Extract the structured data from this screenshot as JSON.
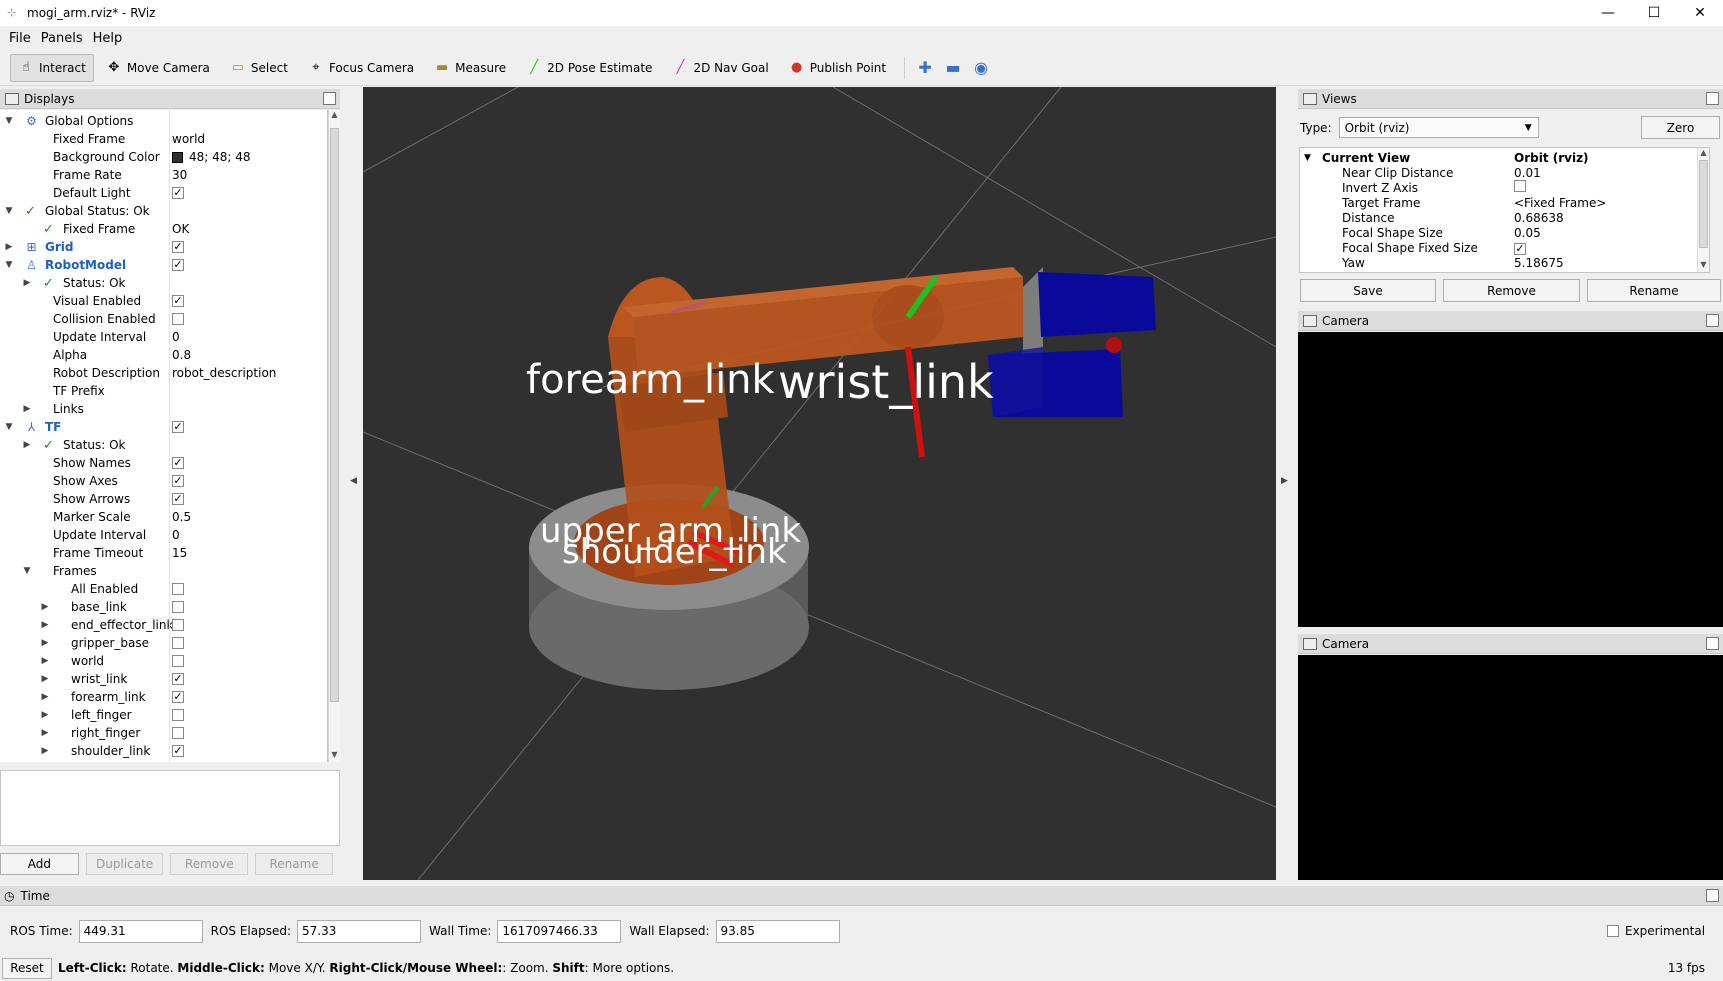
{
  "window": {
    "title": "mogi_arm.rviz* - RViz",
    "minimize": "—",
    "maximize": "☐",
    "close": "✕"
  },
  "menu": [
    "File",
    "Panels",
    "Help"
  ],
  "toolbar": {
    "tools": [
      {
        "label": "Interact",
        "icon": "hand-icon",
        "glyph": "☝",
        "active": true
      },
      {
        "label": "Move Camera",
        "icon": "move-camera-icon",
        "glyph": "✥",
        "active": false
      },
      {
        "label": "Select",
        "icon": "select-icon",
        "glyph": "▭",
        "active": false
      },
      {
        "label": "Focus Camera",
        "icon": "focus-camera-icon",
        "glyph": "⌖",
        "active": false
      },
      {
        "label": "Measure",
        "icon": "measure-icon",
        "glyph": "▬",
        "active": false
      },
      {
        "label": "2D Pose Estimate",
        "icon": "pose-estimate-icon",
        "glyph": "╱",
        "active": false
      },
      {
        "label": "2D Nav Goal",
        "icon": "nav-goal-icon",
        "glyph": "╱",
        "active": false
      },
      {
        "label": "Publish Point",
        "icon": "map-pin-icon",
        "glyph": "📍",
        "active": false
      }
    ],
    "colors": {
      "pose": "#2db52d",
      "nav": "#d02ad0",
      "pin": "#d0342c"
    }
  },
  "displays": {
    "title": "Displays",
    "rows": [
      {
        "name": "Global Options",
        "indent": 0,
        "expander": "▼",
        "icon": "gear-icon"
      },
      {
        "name": "Fixed Frame",
        "indent": 1,
        "value": "world"
      },
      {
        "name": "Background Color",
        "indent": 1,
        "value": "48; 48; 48",
        "swatch": true
      },
      {
        "name": "Frame Rate",
        "indent": 1,
        "value": "30"
      },
      {
        "name": "Default Light",
        "indent": 1,
        "check": true
      },
      {
        "name": "Global Status: Ok",
        "indent": 0,
        "expander": "▼",
        "ok": true
      },
      {
        "name": "Fixed Frame",
        "indent": 1,
        "value": "OK",
        "ok": true
      },
      {
        "name": "Grid",
        "indent": 0,
        "expander": "▶",
        "icon": "grid-icon",
        "blue": true,
        "check": true
      },
      {
        "name": "RobotModel",
        "indent": 0,
        "expander": "▼",
        "icon": "robot-icon",
        "blue": true,
        "check": true
      },
      {
        "name": "Status: Ok",
        "indent": 1,
        "expander": "▶",
        "ok": true
      },
      {
        "name": "Visual Enabled",
        "indent": 1,
        "check": true
      },
      {
        "name": "Collision Enabled",
        "indent": 1,
        "check": false
      },
      {
        "name": "Update Interval",
        "indent": 1,
        "value": "0"
      },
      {
        "name": "Alpha",
        "indent": 1,
        "value": "0.8"
      },
      {
        "name": "Robot Description",
        "indent": 1,
        "value": "robot_description"
      },
      {
        "name": "TF Prefix",
        "indent": 1,
        "value": ""
      },
      {
        "name": "Links",
        "indent": 1,
        "expander": "▶"
      },
      {
        "name": "TF",
        "indent": 0,
        "expander": "▼",
        "icon": "tf-icon",
        "blue": true,
        "check": true
      },
      {
        "name": "Status: Ok",
        "indent": 1,
        "expander": "▶",
        "ok": true
      },
      {
        "name": "Show Names",
        "indent": 1,
        "check": true
      },
      {
        "name": "Show Axes",
        "indent": 1,
        "check": true
      },
      {
        "name": "Show Arrows",
        "indent": 1,
        "check": true
      },
      {
        "name": "Marker Scale",
        "indent": 1,
        "value": "0.5"
      },
      {
        "name": "Update Interval",
        "indent": 1,
        "value": "0"
      },
      {
        "name": "Frame Timeout",
        "indent": 1,
        "value": "15"
      },
      {
        "name": "Frames",
        "indent": 1,
        "expander": "▼"
      },
      {
        "name": "All Enabled",
        "indent": 2,
        "check": false
      },
      {
        "name": "base_link",
        "indent": 2,
        "expander": "▶",
        "check": false
      },
      {
        "name": "end_effector_link",
        "indent": 2,
        "expander": "▶",
        "check": false
      },
      {
        "name": "gripper_base",
        "indent": 2,
        "expander": "▶",
        "check": false
      },
      {
        "name": "world",
        "indent": 2,
        "expander": "▶",
        "check": false
      },
      {
        "name": "wrist_link",
        "indent": 2,
        "expander": "▶",
        "check": true
      },
      {
        "name": "forearm_link",
        "indent": 2,
        "expander": "▶",
        "check": true
      },
      {
        "name": "left_finger",
        "indent": 2,
        "expander": "▶",
        "check": false
      },
      {
        "name": "right_finger",
        "indent": 2,
        "expander": "▶",
        "check": false
      },
      {
        "name": "shoulder_link",
        "indent": 2,
        "expander": "▶",
        "check": true
      }
    ],
    "buttons": {
      "add": "Add",
      "duplicate": "Duplicate",
      "remove": "Remove",
      "rename": "Rename"
    }
  },
  "viewport": {
    "labels": {
      "forearm": "forearm_link",
      "wrist": "wrist_link",
      "upper_arm": "upper_arm_link",
      "shoulder": "shoulder_link"
    },
    "colors": {
      "background": "#303030",
      "robot": "#c8501a",
      "gripper": "#0a0a9a",
      "base": "#8a8a8a"
    }
  },
  "views": {
    "title": "Views",
    "type_label": "Type:",
    "type_value": "Orbit (rviz)",
    "zero": "Zero",
    "current_view": "Current View",
    "current_view_value": "Orbit (rviz)",
    "props": [
      {
        "name": "Near Clip Distance",
        "value": "0.01"
      },
      {
        "name": "Invert Z Axis",
        "check": false
      },
      {
        "name": "Target Frame",
        "value": "<Fixed Frame>"
      },
      {
        "name": "Distance",
        "value": "0.68638"
      },
      {
        "name": "Focal Shape Size",
        "value": "0.05"
      },
      {
        "name": "Focal Shape Fixed Size",
        "check": true
      },
      {
        "name": "Yaw",
        "value": "5.18675"
      }
    ],
    "buttons": {
      "save": "Save",
      "remove": "Remove",
      "rename": "Rename"
    }
  },
  "camera1": {
    "title": "Camera"
  },
  "camera2": {
    "title": "Camera"
  },
  "time": {
    "title": "Time",
    "ros_time_label": "ROS Time:",
    "ros_time": "449.31",
    "ros_elapsed_label": "ROS Elapsed:",
    "ros_elapsed": "57.33",
    "wall_time_label": "Wall Time:",
    "wall_time": "1617097466.33",
    "wall_elapsed_label": "Wall Elapsed:",
    "wall_elapsed": "93.85",
    "experimental": "Experimental"
  },
  "status": {
    "reset": "Reset",
    "hint_1b": "Left-Click:",
    "hint_1": " Rotate. ",
    "hint_2b": "Middle-Click:",
    "hint_2": " Move X/Y. ",
    "hint_3b": "Right-Click/Mouse Wheel:",
    "hint_3": ": Zoom. ",
    "hint_4b": "Shift",
    "hint_4": ": More options.",
    "fps": "13 fps"
  }
}
